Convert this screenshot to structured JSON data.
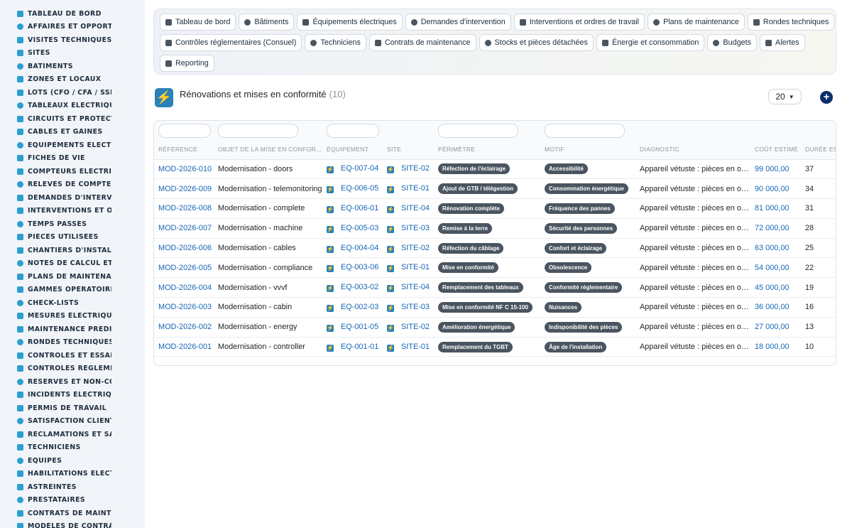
{
  "sidebar": {
    "items": [
      {
        "label": "TABLEAU DE BORD",
        "icon": "dashboard-icon"
      },
      {
        "label": "AFFAIRES ET OPPORTUNITÉS",
        "icon": "target-icon"
      },
      {
        "label": "VISITES TECHNIQUES ET RELEVÉS",
        "icon": "pin-icon"
      },
      {
        "label": "SITES",
        "icon": "map-pin-icon"
      },
      {
        "label": "BÂTIMENTS",
        "icon": "building-icon"
      },
      {
        "label": "ZONES ET LOCAUX",
        "icon": "grid-icon"
      },
      {
        "label": "LOTS (CFO / CFA / SSI...)",
        "icon": "sitemap-icon"
      },
      {
        "label": "TABLEAUX ÉLECTRIQUES",
        "icon": "table-icon"
      },
      {
        "label": "CIRCUITS ET PROTECTIONS",
        "icon": "plug-icon"
      },
      {
        "label": "CÂBLES ET GAINES",
        "icon": "lines-icon"
      },
      {
        "label": "ÉQUIPEMENTS ÉLECTRIQUES",
        "icon": "cogs-icon"
      },
      {
        "label": "FICHES DE VIE",
        "icon": "history-icon"
      },
      {
        "label": "COMPTEURS ÉLECTRIQUES",
        "icon": "gauge-icon"
      },
      {
        "label": "RELEVÉS DE COMPTEURS",
        "icon": "clipboard-icon"
      },
      {
        "label": "DEMANDES D'INTERVENTION",
        "icon": "question-icon"
      },
      {
        "label": "INTERVENTIONS ET ORDRES DE TRAVAIL",
        "icon": "clipboard-check-icon"
      },
      {
        "label": "TEMPS PASSÉS",
        "icon": "clock-icon"
      },
      {
        "label": "PIÈCES UTILISÉES",
        "icon": "cubes-icon"
      },
      {
        "label": "CHANTIERS D'INSTALLATION",
        "icon": "hammer-icon"
      },
      {
        "label": "NOTES DE CALCUL ET ÉTUDES",
        "icon": "calculator-icon"
      },
      {
        "label": "PLANS DE MAINTENANCE",
        "icon": "calendar-icon"
      },
      {
        "label": "GAMMES OPÉRATOIRES",
        "icon": "list-icon"
      },
      {
        "label": "CHECK-LISTS",
        "icon": "checklist-icon"
      },
      {
        "label": "MESURES ÉLECTRIQUES",
        "icon": "thermometer-icon"
      },
      {
        "label": "MAINTENANCE PRÉDICTIVE",
        "icon": "chart-icon"
      },
      {
        "label": "RONDES TECHNIQUES",
        "icon": "route-icon"
      },
      {
        "label": "CONTRÔLES ET ESSAIS",
        "icon": "search-icon"
      },
      {
        "label": "CONTRÔLES RÉGLEMENTAIRES",
        "icon": "clipboard-icon"
      },
      {
        "label": "RÉSERVES ET NON-CONFORMITÉS",
        "icon": "exclamation-icon"
      },
      {
        "label": "INCIDENTS ÉLECTRIQUES",
        "icon": "warning-icon"
      },
      {
        "label": "PERMIS DE TRAVAIL",
        "icon": "file-signature-icon"
      },
      {
        "label": "SATISFACTION CLIENT",
        "icon": "smile-icon"
      },
      {
        "label": "RÉCLAMATIONS ET SAV",
        "icon": "comment-icon"
      },
      {
        "label": "TECHNICIENS",
        "icon": "hardhat-icon"
      },
      {
        "label": "ÉQUIPES",
        "icon": "users-icon"
      },
      {
        "label": "HABILITATIONS ÉLECTRIQUES",
        "icon": "certificate-icon"
      },
      {
        "label": "ASTREINTES",
        "icon": "phone-icon"
      },
      {
        "label": "PRESTATAIRES",
        "icon": "handshake-icon"
      },
      {
        "label": "CONTRATS DE MAINTENANCE",
        "icon": "file-contract-icon"
      },
      {
        "label": "MODÈLES DE CONTRATS",
        "icon": "file-icon"
      }
    ]
  },
  "topnav": {
    "row1": [
      {
        "label": "Tableau de bord",
        "icon": "dashboard-icon"
      },
      {
        "label": "Bâtiments",
        "icon": "building-icon"
      },
      {
        "label": "Équipements électriques",
        "icon": "cogs-icon"
      },
      {
        "label": "Demandes d'intervention",
        "icon": "question-icon"
      },
      {
        "label": "Interventions et ordres de travail",
        "icon": "clipboard-check-icon"
      },
      {
        "label": "Plans de maintenance",
        "icon": "calendar-icon"
      },
      {
        "label": "Rondes techniques",
        "icon": "route-icon"
      }
    ],
    "row2": [
      {
        "label": "Contrôles réglementaires (Consuel)",
        "icon": "clipboard-check-icon"
      },
      {
        "label": "Techniciens",
        "icon": "hardhat-icon"
      },
      {
        "label": "Contrats de maintenance",
        "icon": "file-contract-icon"
      },
      {
        "label": "Stocks et pièces détachées",
        "icon": "cubes-icon"
      },
      {
        "label": "Énergie et consommation",
        "icon": "bolt-icon"
      },
      {
        "label": "Budgets",
        "icon": "money-icon"
      },
      {
        "label": "Alertes",
        "icon": "bell-icon"
      }
    ],
    "row3": [
      {
        "label": "Reporting",
        "icon": "chart-pie-icon"
      }
    ]
  },
  "header": {
    "title": "Rénovations et mises en conformité",
    "count": "(10)",
    "page_size": "20",
    "add_label": "+"
  },
  "colors": {
    "accent": "#1766b5",
    "badge": "#4a5561",
    "sidebar_icon": "#2b9fd1",
    "add_button": "#0d2d6b"
  },
  "table": {
    "columns": [
      "RÉFÉRENCE",
      "OBJET DE LA MISE EN CONFORMITÉ",
      "ÉQUIPEMENT",
      "SITE",
      "PÉRIMÈTRE",
      "MOTIF",
      "DIAGNOSTIC",
      "COÛT ESTIMÉ",
      "DURÉE ESTIMÉE"
    ],
    "rows": [
      {
        "ref": "MOD-2026-010",
        "objet": "Modernisation - doors",
        "equipement": "EQ-007-04",
        "site": "SITE-02",
        "perimetre": "Réfection de l'éclairage",
        "motif": "Accessibilité",
        "diagnostic": "Appareil vétuste : pièces en obsolescence",
        "cout": "99 000,00",
        "duree": "37"
      },
      {
        "ref": "MOD-2026-009",
        "objet": "Modernisation - telemonitoring",
        "equipement": "EQ-006-05",
        "site": "SITE-01",
        "perimetre": "Ajout de GTB / télégestion",
        "motif": "Consommation énergétique",
        "diagnostic": "Appareil vétuste : pièces en obsolescence",
        "cout": "90 000,00",
        "duree": "34"
      },
      {
        "ref": "MOD-2026-008",
        "objet": "Modernisation - complete",
        "equipement": "EQ-006-01",
        "site": "SITE-04",
        "perimetre": "Rénovation complète",
        "motif": "Fréquence des pannes",
        "diagnostic": "Appareil vétuste : pièces en obsolescence",
        "cout": "81 000,00",
        "duree": "31"
      },
      {
        "ref": "MOD-2026-007",
        "objet": "Modernisation - machine",
        "equipement": "EQ-005-03",
        "site": "SITE-03",
        "perimetre": "Remise à la terre",
        "motif": "Sécurité des personnes",
        "diagnostic": "Appareil vétuste : pièces en obsolescence",
        "cout": "72 000,00",
        "duree": "28"
      },
      {
        "ref": "MOD-2026-006",
        "objet": "Modernisation - cables",
        "equipement": "EQ-004-04",
        "site": "SITE-02",
        "perimetre": "Réfection du câblage",
        "motif": "Confort et éclairage",
        "diagnostic": "Appareil vétuste : pièces en obsolescence",
        "cout": "63 000,00",
        "duree": "25"
      },
      {
        "ref": "MOD-2026-005",
        "objet": "Modernisation - compliance",
        "equipement": "EQ-003-06",
        "site": "SITE-01",
        "perimetre": "Mise en conformité",
        "motif": "Obsolescence",
        "diagnostic": "Appareil vétuste : pièces en obsolescence",
        "cout": "54 000,00",
        "duree": "22"
      },
      {
        "ref": "MOD-2026-004",
        "objet": "Modernisation - vvvf",
        "equipement": "EQ-003-02",
        "site": "SITE-04",
        "perimetre": "Remplacement des tableaux",
        "motif": "Conformité réglementaire",
        "diagnostic": "Appareil vétuste : pièces en obsolescence",
        "cout": "45 000,00",
        "duree": "19"
      },
      {
        "ref": "MOD-2026-003",
        "objet": "Modernisation - cabin",
        "equipement": "EQ-002-03",
        "site": "SITE-03",
        "perimetre": "Mise en conformité NF C 15-100",
        "motif": "Nuisances",
        "diagnostic": "Appareil vétuste : pièces en obsolescence",
        "cout": "36 000,00",
        "duree": "16"
      },
      {
        "ref": "MOD-2026-002",
        "objet": "Modernisation - energy",
        "equipement": "EQ-001-05",
        "site": "SITE-02",
        "perimetre": "Amélioration énergétique",
        "motif": "Indisponibilité des pièces",
        "diagnostic": "Appareil vétuste : pièces en obsolescence",
        "cout": "27 000,00",
        "duree": "13"
      },
      {
        "ref": "MOD-2026-001",
        "objet": "Modernisation - controller",
        "equipement": "EQ-001-01",
        "site": "SITE-01",
        "perimetre": "Remplacement du TGBT",
        "motif": "Âge de l'installation",
        "diagnostic": "Appareil vétuste : pièces en obsolescence",
        "cout": "18 000,00",
        "duree": "10"
      }
    ]
  }
}
